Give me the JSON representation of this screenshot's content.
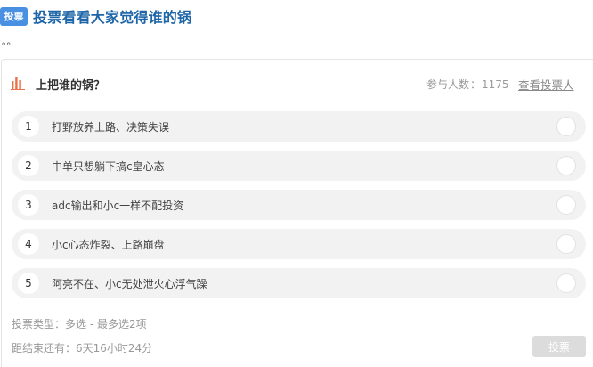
{
  "header": {
    "tag": "投票",
    "title": "投票看看大家觉得谁的锅",
    "subtext": "。。"
  },
  "poll": {
    "question": "上把谁的锅？",
    "participants_label": "参与人数",
    "participants_sep": "：",
    "participants_count": "1175",
    "view_voters": "查看投票人",
    "options": [
      {
        "num": "1",
        "text": "打野放养上路、决策失误"
      },
      {
        "num": "2",
        "text": "中单只想躺下搞c皇心态"
      },
      {
        "num": "3",
        "text": "adc输出和小c一样不配投资"
      },
      {
        "num": "4",
        "text": "小c心态炸裂、上路崩盘"
      },
      {
        "num": "5",
        "text": "阿亮不在、小c无处泄火心浮气躁"
      }
    ],
    "vote_type": "投票类型：多选 - 最多选2项",
    "time_left": "距结束还有：6天16小时24分",
    "submit_label": "投票"
  },
  "colors": {
    "tag_bg": "#4a90e2",
    "title": "#1f66a8",
    "chart_icon": "#e8734a",
    "option_bg": "#f2f2f2",
    "submit_disabled": "#dcdcdc"
  },
  "icons": {
    "poll": "bar-chart-icon",
    "choice": "radio-circle-icon"
  }
}
